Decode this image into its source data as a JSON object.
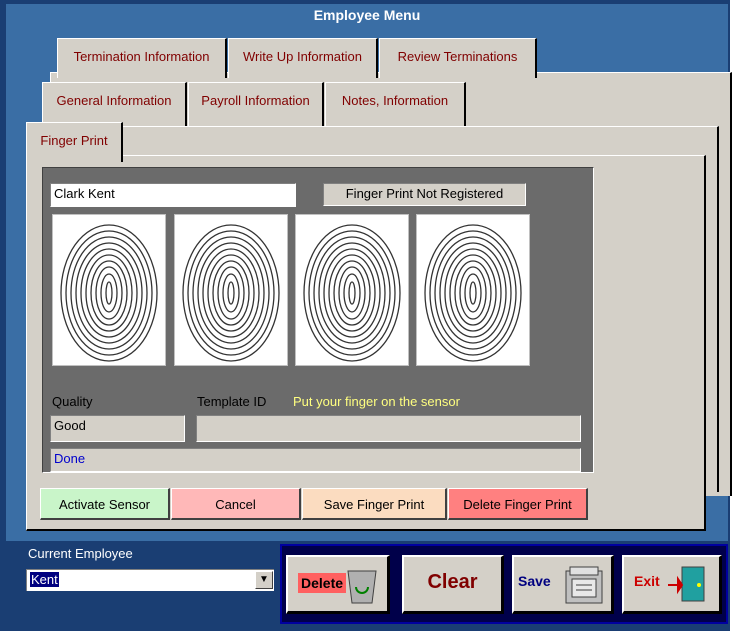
{
  "window": {
    "title": "Employee Menu"
  },
  "tabs_row1": [
    "Termination Information",
    "Write Up Information",
    "Review Terminations"
  ],
  "tabs_row2": [
    "General Information",
    "Payroll Information",
    "Notes, Information"
  ],
  "tabs_row3": [
    "Finger Print"
  ],
  "fingerprint": {
    "employee_name": "Clark Kent",
    "status": "Finger Print Not Registered",
    "quality_label": "Quality",
    "quality_value": "Good",
    "template_label": "Template ID",
    "template_value": "",
    "instruction": "Put your finger on the sensor",
    "progress_text": "Done",
    "buttons": {
      "activate": "Activate Sensor",
      "cancel": "Cancel",
      "save": "Save Finger Print",
      "delete": "Delete Finger Print"
    },
    "button_colors": {
      "activate": "#c9f5c9",
      "cancel": "#ffb8b8",
      "save": "#fbdcc0",
      "delete": "#ff8080"
    }
  },
  "footer": {
    "current_employee_label": "Current Employee",
    "current_employee_value": "Kent",
    "delete_label": "Delete",
    "clear_label": "Clear",
    "save_label": "Save",
    "exit_label": "Exit"
  },
  "colors": {
    "window_bg": "#3a6ea5",
    "panel_bg": "#6b6b6b",
    "tab_text": "#800000",
    "instruction_text": "#ffff80",
    "progress_text": "#0000cc"
  }
}
